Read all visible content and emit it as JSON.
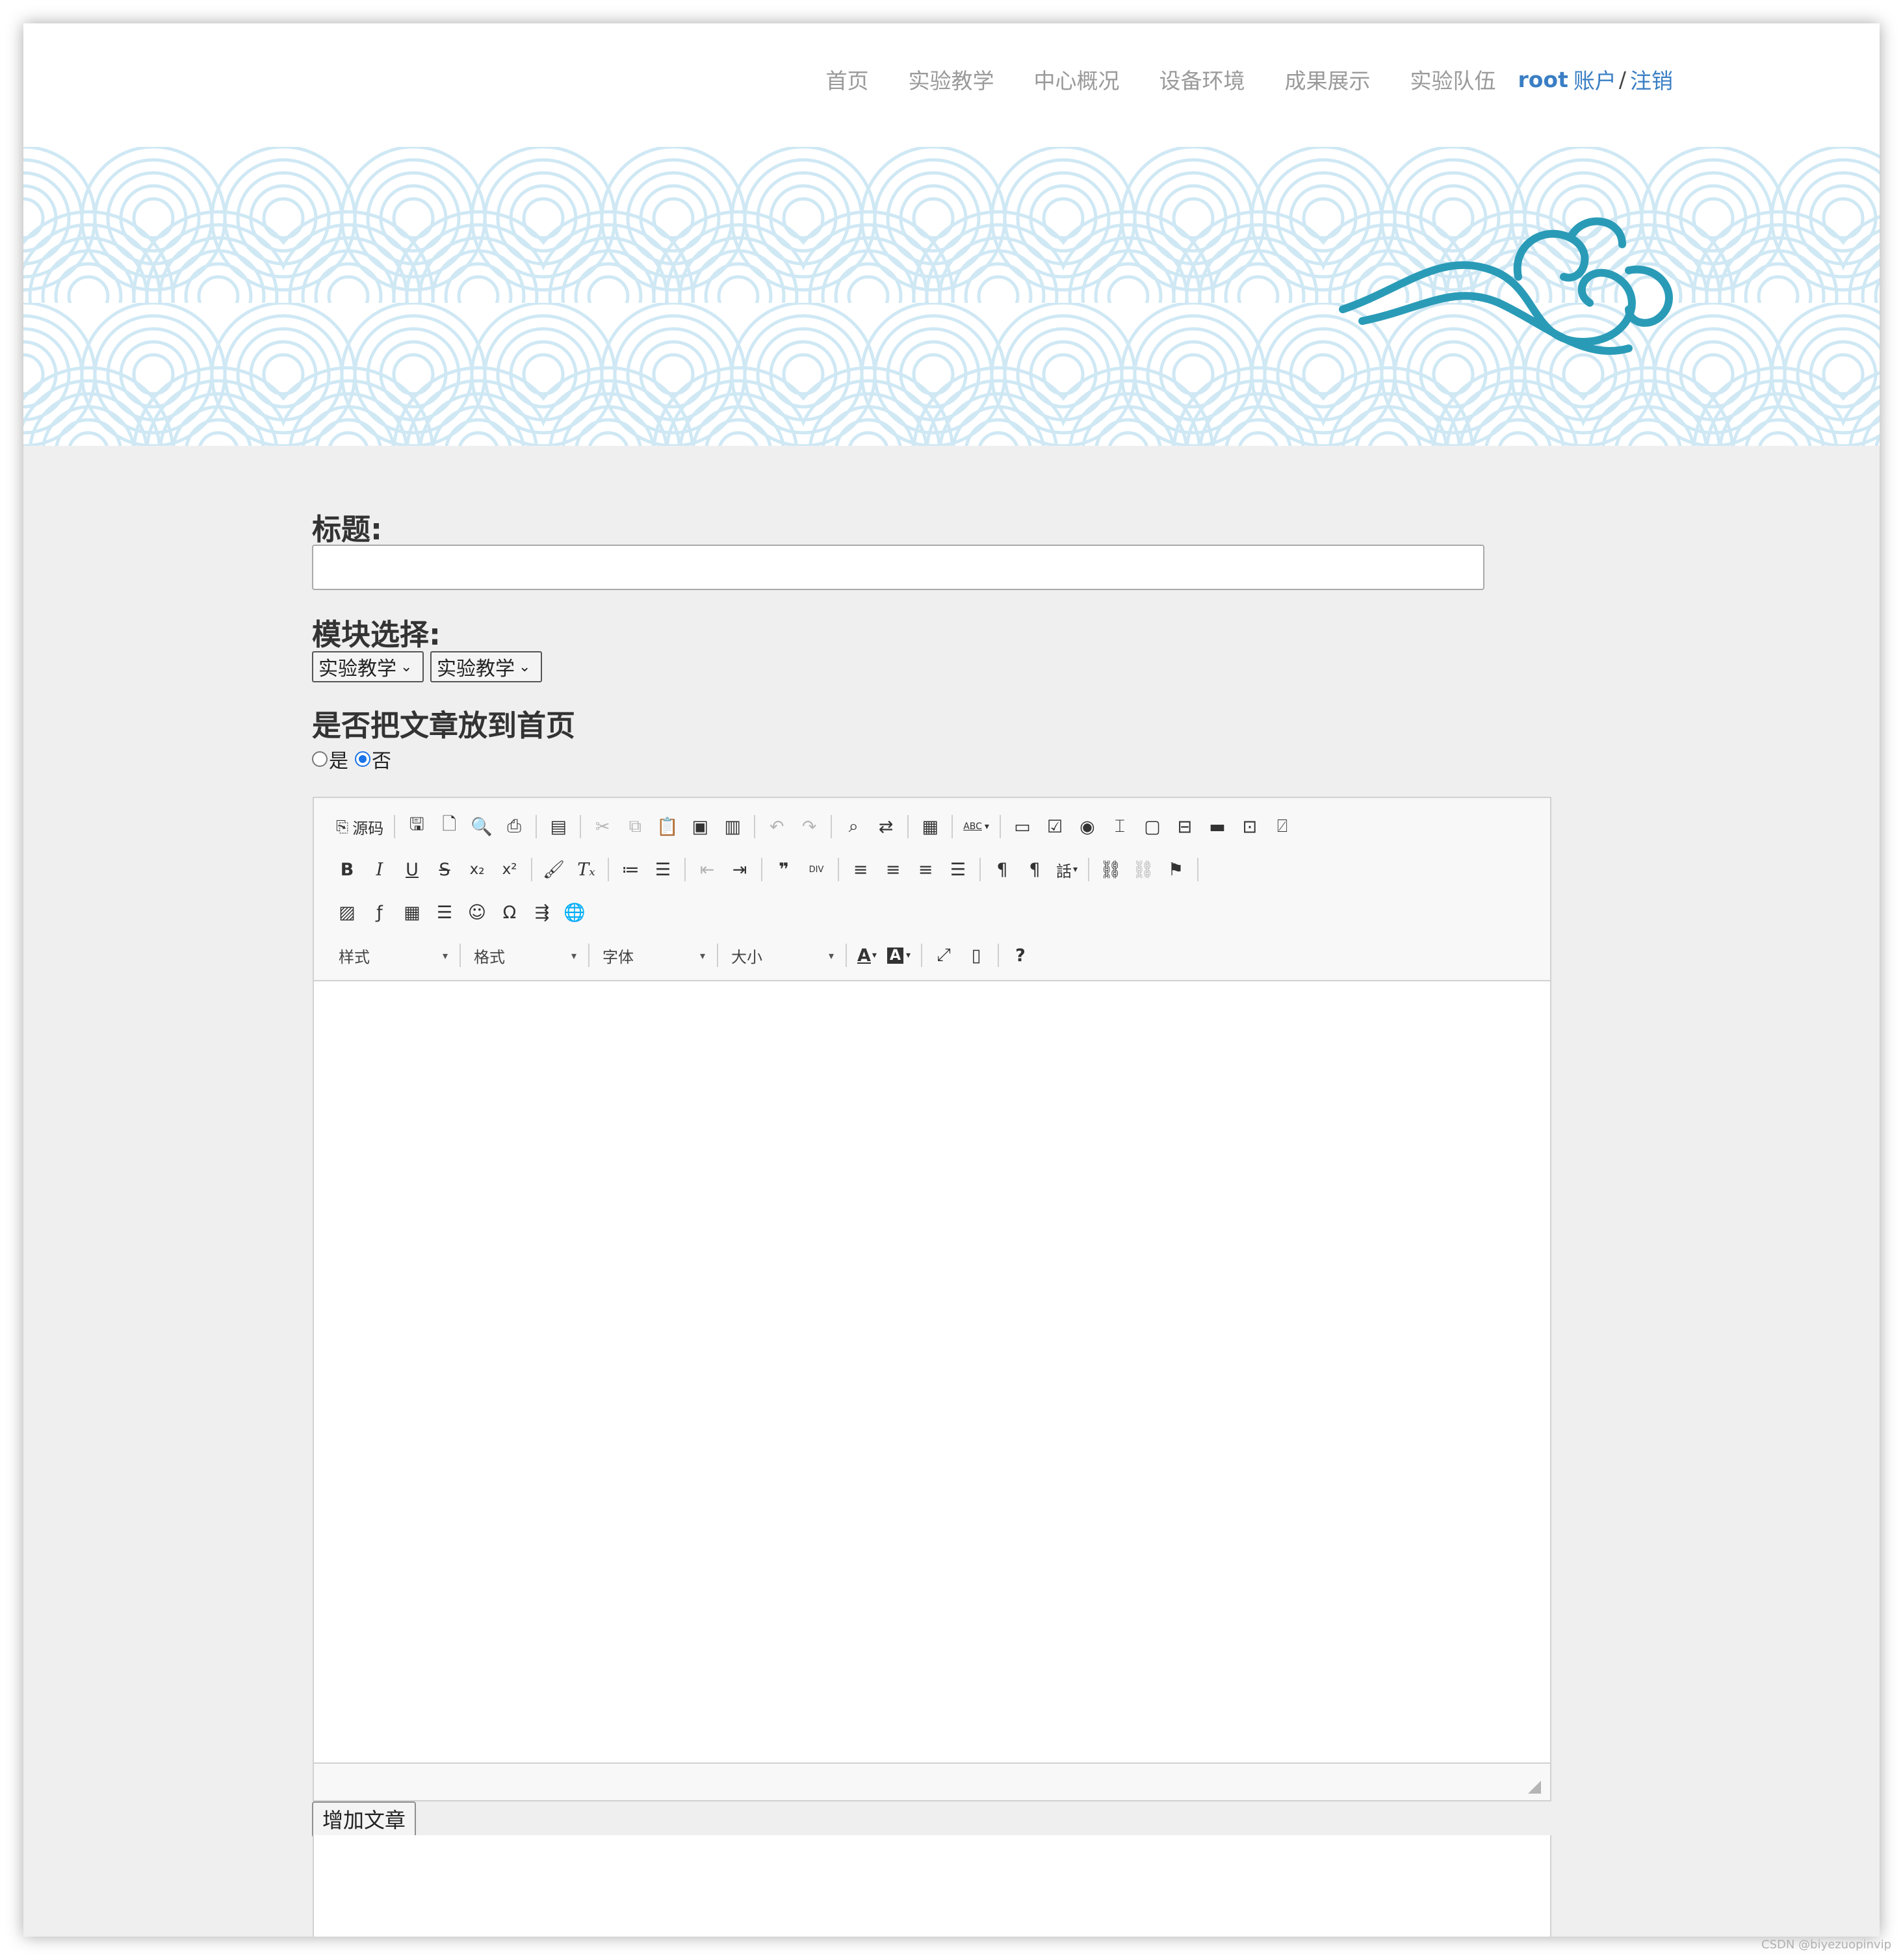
{
  "nav": {
    "links": [
      "首页",
      "实验教学",
      "中心概况",
      "设备环境",
      "成果展示",
      "实验队伍"
    ],
    "user": "root",
    "account_label": "账户",
    "separator": "/",
    "logout_label": "注销"
  },
  "form": {
    "title_label": "标题:",
    "module_label": "模块选择:",
    "module_select_1": "实验教学",
    "module_select_2": "实验教学",
    "homepage_label": "是否把文章放到首页",
    "radio_yes": "是",
    "radio_no": "否",
    "radio_selected": "否",
    "submit_label": "增加文章"
  },
  "editor": {
    "source_label": "源码",
    "style_combo": "样式",
    "format_combo": "格式",
    "font_combo": "字体",
    "size_combo": "大小",
    "help_label": "?",
    "bold": "B",
    "italic": "I",
    "underline": "U",
    "strike": "S",
    "subscript": "x₂",
    "superscript": "x²",
    "removeformat": "Tₓ",
    "blockquote": "❞",
    "div": "DIV",
    "omega": "Ω",
    "abc": "ABC",
    "lang": "話"
  },
  "colors": {
    "accent": "#3a7ec4",
    "nav_text": "#9a9a9a",
    "background": "#f0efef",
    "wave": "#cfe8f4",
    "cloud": "#2a9bb7"
  },
  "watermark": "CSDN @biyezuopinvip"
}
